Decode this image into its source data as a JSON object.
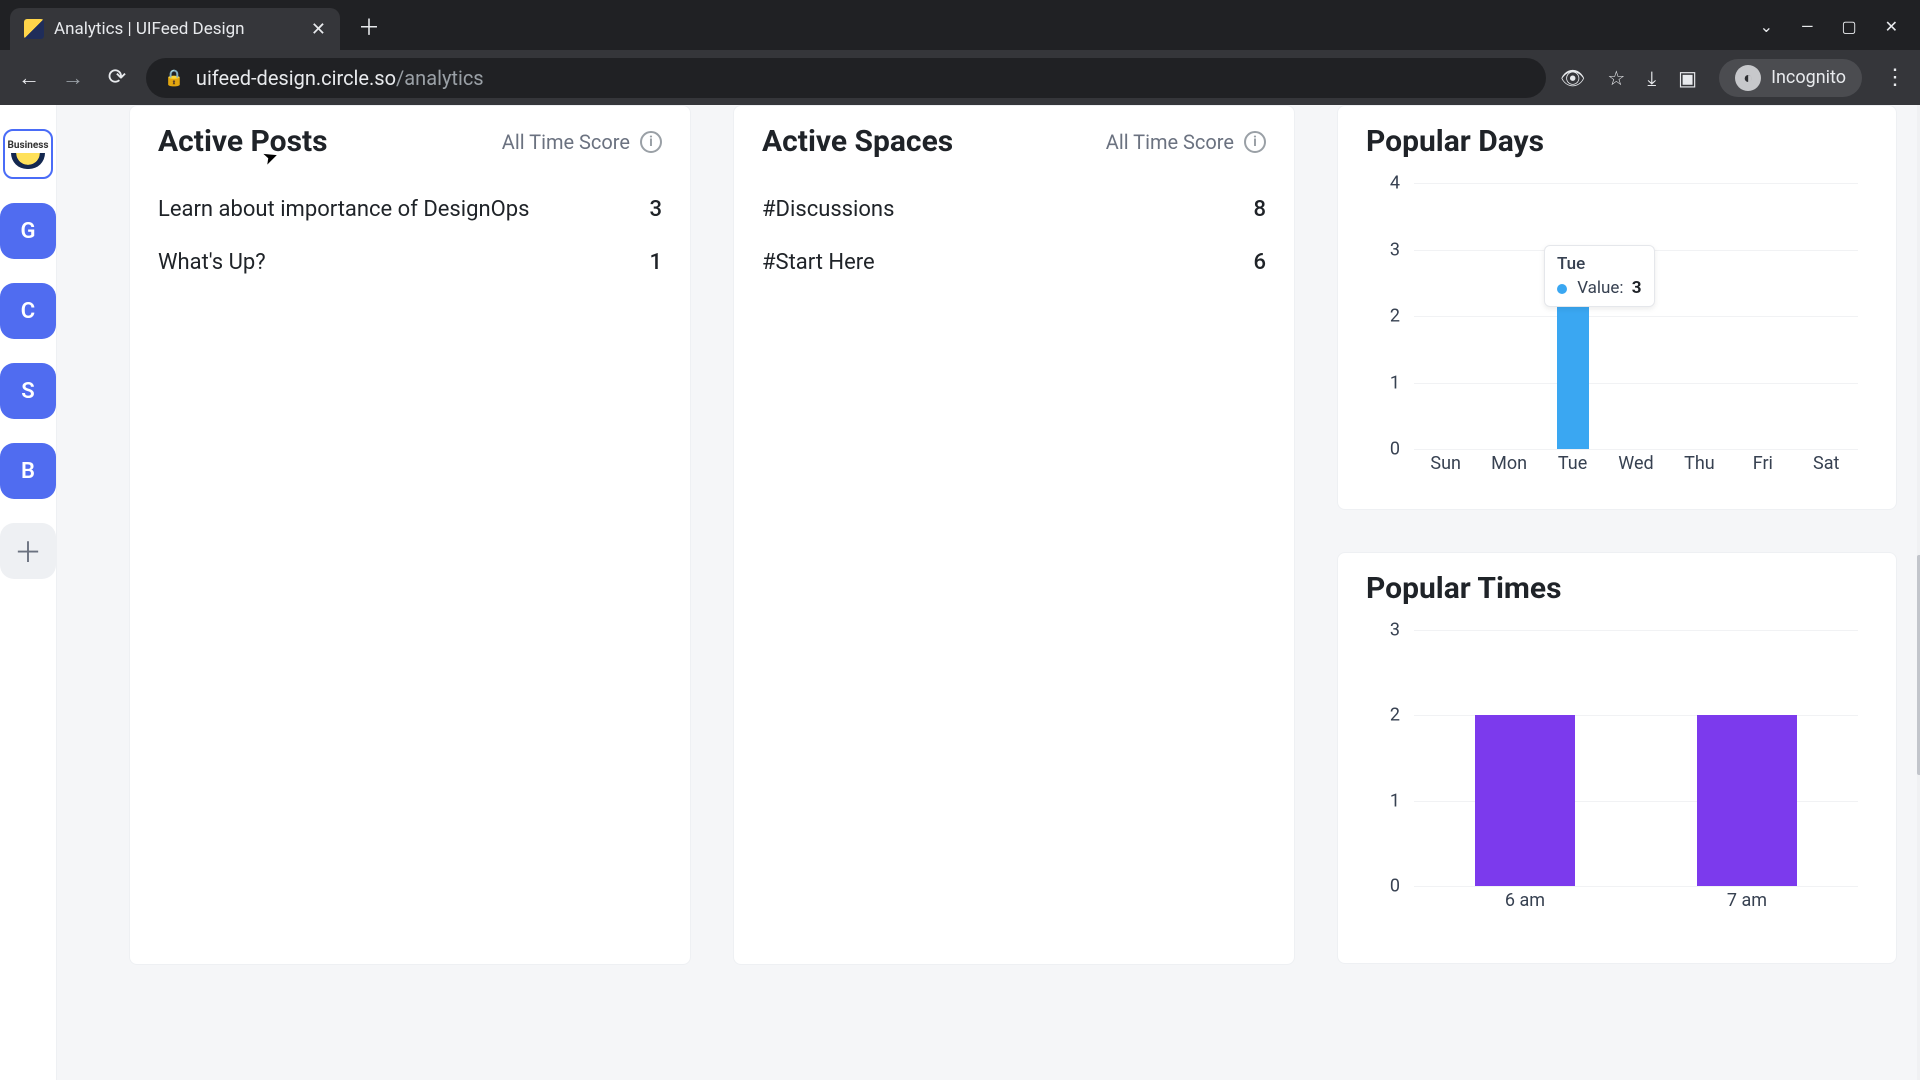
{
  "browser": {
    "tab_title": "Analytics | UIFeed Design",
    "url_host": "uifeed-design.circle.so",
    "url_path": "/analytics",
    "incognito_label": "Incognito"
  },
  "sidebar": {
    "logo_label": "Business",
    "items": [
      "G",
      "C",
      "S",
      "B"
    ]
  },
  "panels": {
    "active_posts": {
      "title": "Active Posts",
      "score_label": "All Time Score",
      "rows": [
        {
          "label": "Learn about importance of DesignOps",
          "value": "3"
        },
        {
          "label": "What's Up?",
          "value": "1"
        }
      ]
    },
    "active_spaces": {
      "title": "Active Spaces",
      "score_label": "All Time Score",
      "rows": [
        {
          "label": "#Discussions",
          "value": "8"
        },
        {
          "label": "#Start Here",
          "value": "6"
        }
      ]
    },
    "popular_days": {
      "title": "Popular Days",
      "tooltip": {
        "category": "Tue",
        "label": "Value:",
        "value": "3"
      }
    },
    "popular_times": {
      "title": "Popular Times"
    }
  },
  "chart_data": [
    {
      "id": "popular_days",
      "type": "bar",
      "title": "Popular Days",
      "categories": [
        "Sun",
        "Mon",
        "Tue",
        "Wed",
        "Thu",
        "Fri",
        "Sat"
      ],
      "values": [
        0,
        0,
        3,
        0,
        0,
        0,
        0
      ],
      "ylim": [
        0,
        4
      ],
      "yticks": [
        0,
        1,
        2,
        3,
        4
      ],
      "highlight_index": 2,
      "color": "#3aa7f2"
    },
    {
      "id": "popular_times",
      "type": "bar",
      "title": "Popular Times",
      "categories": [
        "6 am",
        "7 am"
      ],
      "values": [
        2,
        2
      ],
      "ylim": [
        0,
        3
      ],
      "yticks": [
        0,
        1,
        2,
        3
      ],
      "color": "#7c3aed"
    }
  ]
}
